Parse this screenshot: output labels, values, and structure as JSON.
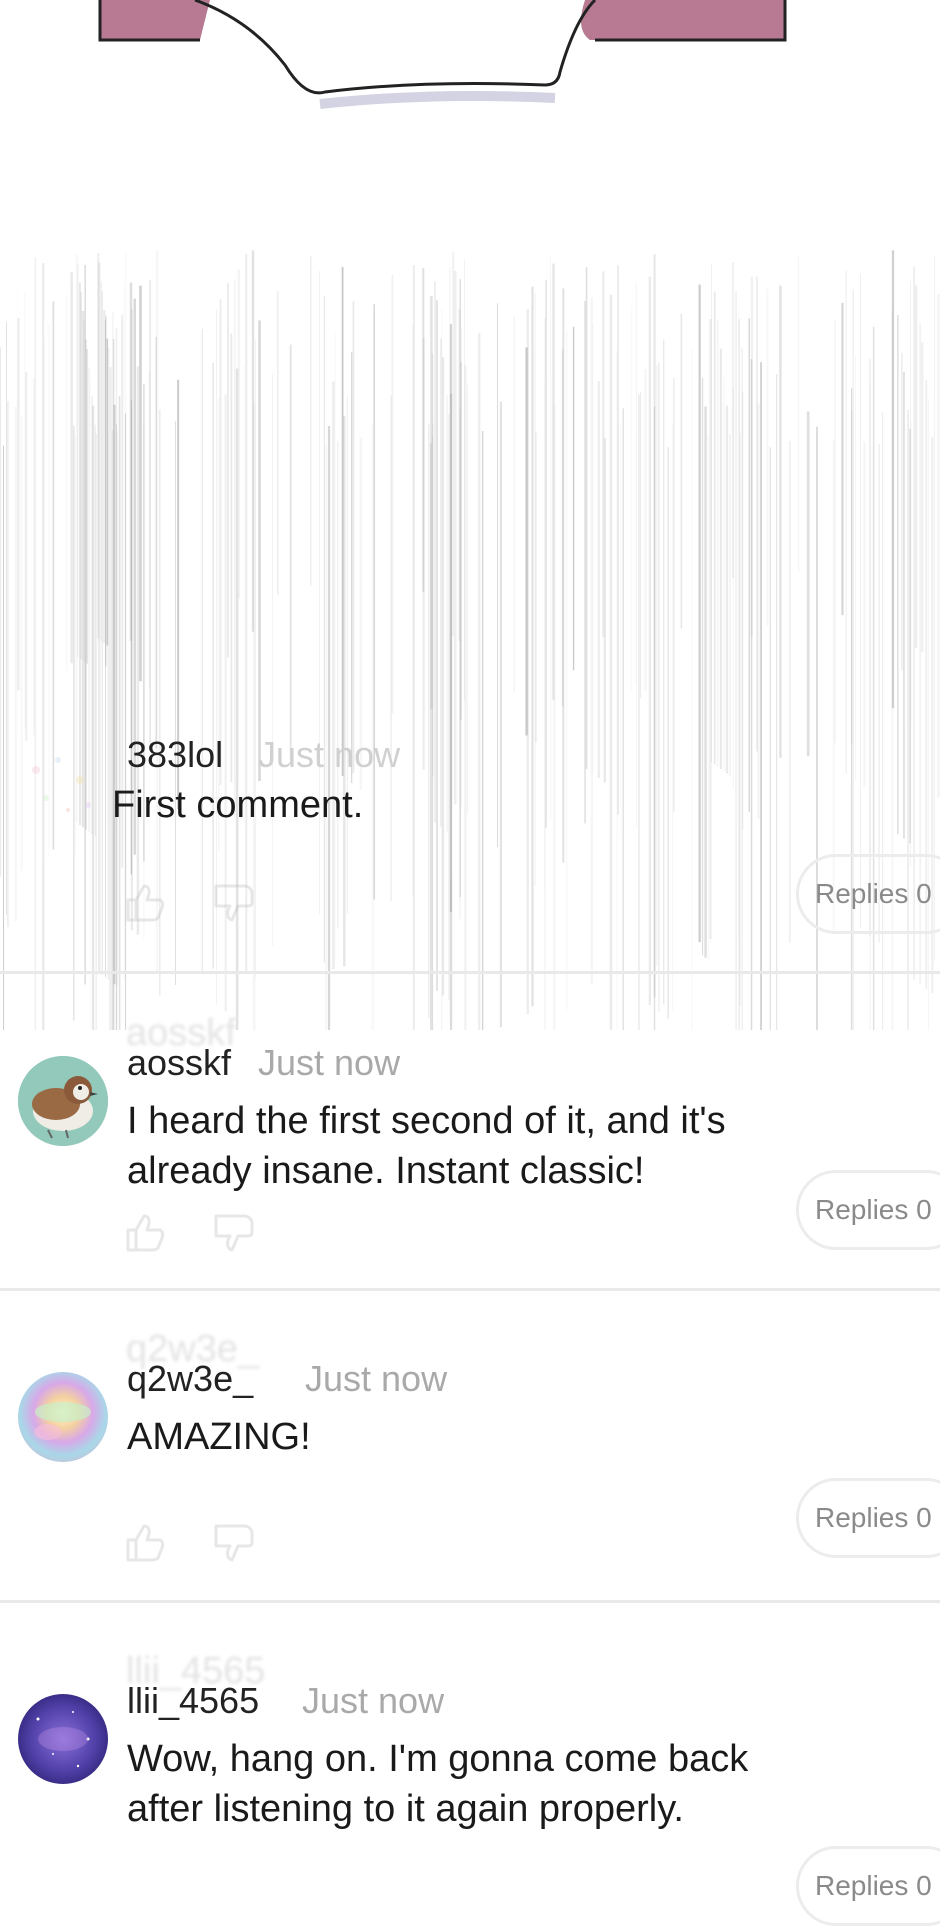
{
  "comments": [
    {
      "username": "383lol",
      "time": "Just now",
      "text": "First comment.",
      "replies_label": "Replies 0",
      "avatar": "confetti-avatar-icon"
    },
    {
      "username": "aosskf",
      "time": "Just now",
      "text": "I heard the first second of it, and it's already insane. Instant classic!",
      "replies_label": "Replies 0",
      "avatar": "sparrow-avatar-icon"
    },
    {
      "username": "q2w3e_",
      "time": "Just now",
      "text": "AMAZING!",
      "replies_label": "Replies 0",
      "avatar": "iridescent-avatar-icon"
    },
    {
      "username": "llii_4565",
      "time": "Just now",
      "text": "Wow, hang on. I'm gonna come back after listening to it again properly.",
      "replies_label": "Replies 0",
      "avatar": "galaxy-avatar-icon"
    }
  ],
  "icons": {
    "like": "thumbs-up-icon",
    "dislike": "thumbs-down-icon"
  },
  "colors": {
    "panel_fill": "#b77a92",
    "timestamp": "#a9a9a9",
    "divider": "#e9e9e9"
  }
}
